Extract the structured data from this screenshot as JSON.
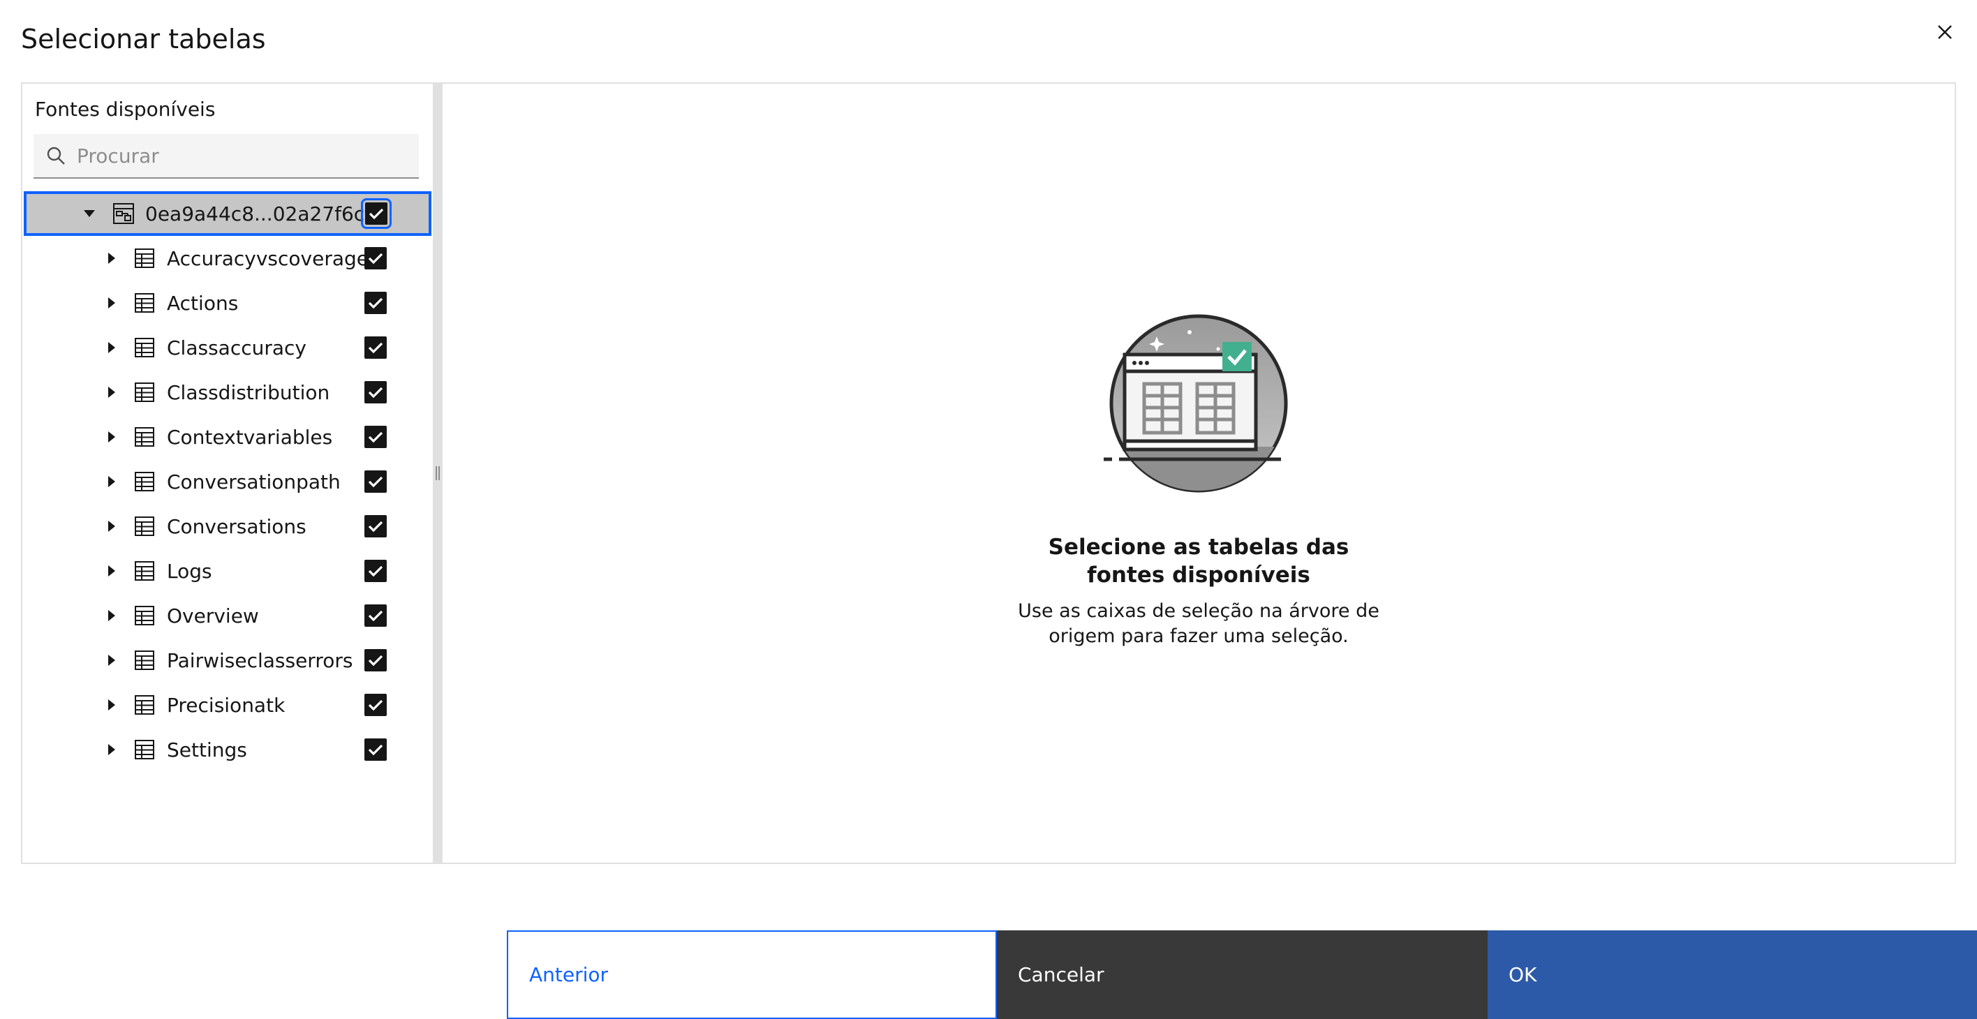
{
  "modal": {
    "title": "Selecionar tabelas",
    "close_icon": "close-icon"
  },
  "sources": {
    "label": "Fontes disponíveis",
    "search_placeholder": "Procurar",
    "search_value": "",
    "root": {
      "label": "0ea9a44c8...02a27f6c",
      "icon": "schema-icon",
      "expanded": true,
      "checked": true
    },
    "tables": [
      {
        "label": "Accuracyvscoverage",
        "checked": true
      },
      {
        "label": "Actions",
        "checked": true
      },
      {
        "label": "Classaccuracy",
        "checked": true
      },
      {
        "label": "Classdistribution",
        "checked": true
      },
      {
        "label": "Contextvariables",
        "checked": true
      },
      {
        "label": "Conversationpath",
        "checked": true
      },
      {
        "label": "Conversations",
        "checked": true
      },
      {
        "label": "Logs",
        "checked": true
      },
      {
        "label": "Overview",
        "checked": true
      },
      {
        "label": "Pairwiseclasserrors",
        "checked": true
      },
      {
        "label": "Precisionatk",
        "checked": true
      },
      {
        "label": "Settings",
        "checked": true
      }
    ]
  },
  "empty_state": {
    "title": "Selecione as tabelas das fontes disponíveis",
    "body": "Use as caixas de seleção na árvore de origem para fazer uma seleção."
  },
  "footer": {
    "back_label": "Anterior",
    "cancel_label": "Cancelar",
    "ok_label": "OK"
  },
  "colors": {
    "accent": "#0f62fe",
    "primary_button": "#2d5aa8",
    "secondary_button": "#393939",
    "selected_row": "#c6c6c6",
    "checkmark_badge": "#42b08f"
  }
}
